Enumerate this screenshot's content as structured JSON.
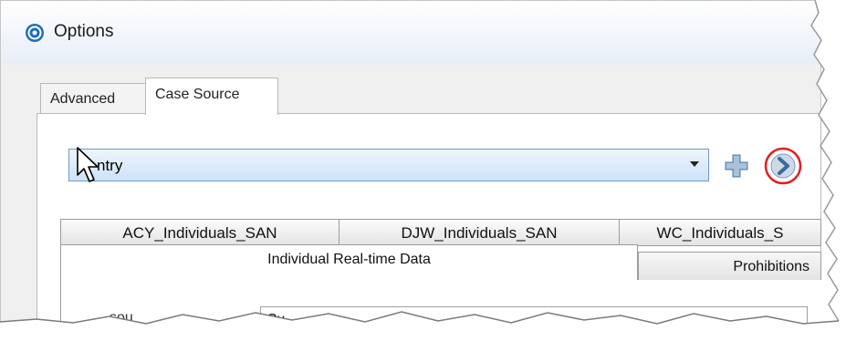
{
  "window": {
    "title": "Options"
  },
  "tabs": [
    {
      "label": "Advanced",
      "active": false
    },
    {
      "label": "Case Source",
      "active": true
    }
  ],
  "case_source": {
    "selected_value": "Entry",
    "visible_text": "ntry"
  },
  "source_tabs": [
    {
      "label": "ACY_Individuals_SAN"
    },
    {
      "label": "DJW_Individuals_SAN"
    },
    {
      "label": "WC_Individuals_S"
    }
  ],
  "inner_tabs": [
    {
      "label": "Individual Real-time Data",
      "active": true
    },
    {
      "label": "Prohibitions",
      "active": false
    }
  ],
  "content": {
    "partial_label": "sou",
    "field_value": "Cu"
  },
  "icons": {
    "app": "options-app-icon",
    "dropdown": "chevron-down-icon",
    "add": "plus-icon",
    "go": "chevron-right-icon",
    "cursor": "mouse-pointer-icon"
  },
  "colors": {
    "accent_blue": "#3b82c4",
    "highlight_ring": "#e02020",
    "combo_fill": "#cde3f8"
  }
}
